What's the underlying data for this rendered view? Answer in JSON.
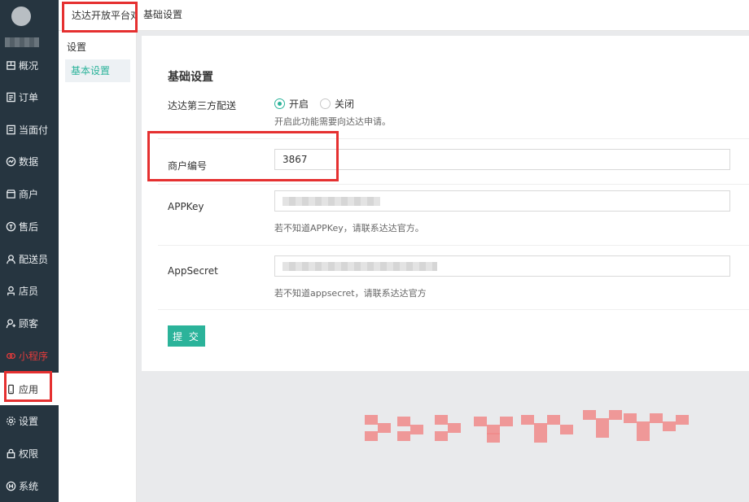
{
  "nav": {
    "items": [
      {
        "label": "概况",
        "icon": "overview-icon"
      },
      {
        "label": "订单",
        "icon": "order-icon"
      },
      {
        "label": "当面付",
        "icon": "pay-icon"
      },
      {
        "label": "数据",
        "icon": "data-icon"
      },
      {
        "label": "商户",
        "icon": "shop-icon"
      },
      {
        "label": "售后",
        "icon": "after-sale-icon"
      },
      {
        "label": "配送员",
        "icon": "courier-icon"
      },
      {
        "label": "店员",
        "icon": "clerk-icon"
      },
      {
        "label": "顾客",
        "icon": "customer-icon"
      },
      {
        "label": "小程序",
        "icon": "miniapp-icon"
      },
      {
        "label": "应用",
        "icon": "app-icon"
      },
      {
        "label": "设置",
        "icon": "gear-icon"
      },
      {
        "label": "权限",
        "icon": "lock-icon"
      },
      {
        "label": "系统",
        "icon": "system-icon"
      }
    ]
  },
  "sidebar": {
    "title": "设置",
    "item": "基本设置"
  },
  "tabs": {
    "active": "达达开放平台对",
    "second": "基础设置"
  },
  "form": {
    "title": "基础设置",
    "delivery": {
      "label": "达达第三方配送",
      "on": "开启",
      "off": "关闭",
      "selected": "开启",
      "hint": "开启此功能需要向达达申请。"
    },
    "merchant_no": {
      "label": "商户编号",
      "value": "3867"
    },
    "appkey": {
      "label": "APPKey",
      "hint": "若不知道APPKey，请联系达达官方。"
    },
    "appsecret": {
      "label": "AppSecret",
      "hint": "若不知道appsecret，请联系达达官方"
    },
    "submit": "提 交"
  },
  "colors": {
    "accent": "#2bb39a",
    "nav_bg": "#263540",
    "annotation": "#e53030"
  }
}
